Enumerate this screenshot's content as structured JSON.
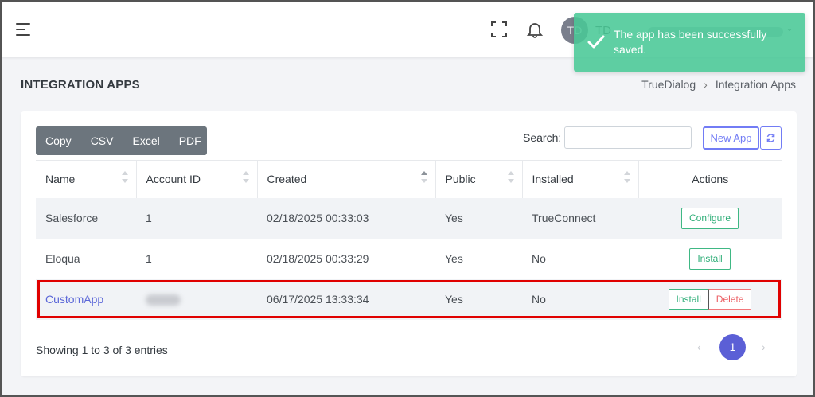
{
  "topbar": {
    "avatar_initials": "TD",
    "user_initials": "TD",
    "icons": [
      "menu-icon",
      "fullscreen-icon",
      "bell-icon",
      "chevron-down-icon"
    ]
  },
  "toast": {
    "message": "The app has been successfully saved.",
    "color": "#49c896"
  },
  "page": {
    "title": "INTEGRATION APPS",
    "breadcrumb": [
      "TrueDialog",
      "Integration Apps"
    ],
    "breadcrumb_sep": "›"
  },
  "toolbar": {
    "export_buttons": [
      "Copy",
      "CSV",
      "Excel",
      "PDF"
    ],
    "search_label": "Search:",
    "search_value": "",
    "new_app_label": "New App"
  },
  "table": {
    "columns": [
      "Name",
      "Account ID",
      "Created",
      "Public",
      "Installed",
      "Actions"
    ],
    "rows": [
      {
        "name": "Salesforce",
        "account_id": "1",
        "created": "02/18/2025 00:33:03",
        "public": "Yes",
        "installed": "TrueConnect",
        "actions": [
          "Configure"
        ]
      },
      {
        "name": "Eloqua",
        "account_id": "1",
        "created": "02/18/2025 00:33:29",
        "public": "Yes",
        "installed": "No",
        "actions": [
          "Install"
        ]
      },
      {
        "name": "CustomApp",
        "account_id": "",
        "created": "06/17/2025 13:33:34",
        "public": "Yes",
        "installed": "No",
        "actions": [
          "Install",
          "Delete"
        ]
      }
    ]
  },
  "footer": {
    "info": "Showing 1 to 3 of 3 entries",
    "prev": "‹",
    "current_page": "1",
    "next": "›"
  },
  "colors": {
    "accent": "#727cf5",
    "success": "#2fae78",
    "danger": "#ec5f64",
    "highlight": "#e00000"
  }
}
